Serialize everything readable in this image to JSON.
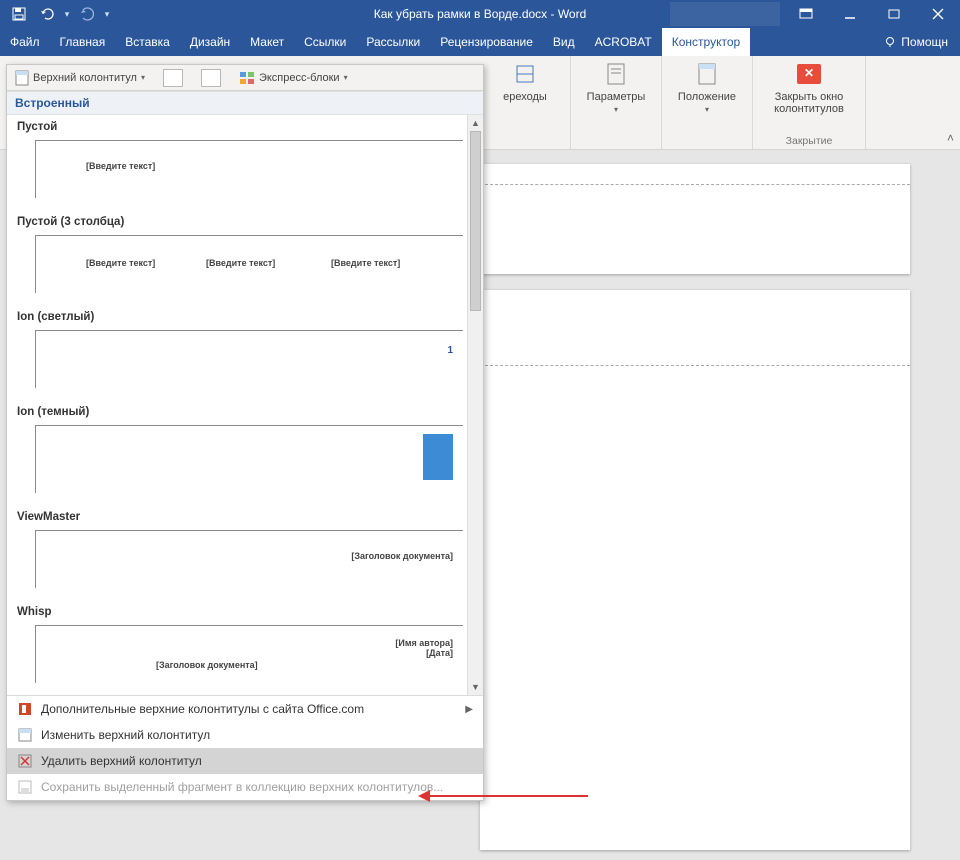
{
  "titlebar": {
    "doc_title": "Как убрать рамки в Ворде.docx - Word"
  },
  "tabs": {
    "file": "Файл",
    "home": "Главная",
    "insert": "Вставка",
    "design": "Дизайн",
    "layout": "Макет",
    "references": "Ссылки",
    "mailings": "Рассылки",
    "review": "Рецензирование",
    "view": "Вид",
    "acrobat": "ACROBAT",
    "constructor": "Конструктор",
    "help": "Помощн"
  },
  "ribbon": {
    "header_split": "Верхний колонтитул",
    "express_blocks": "Экспресс-блоки",
    "transitions": "ереходы",
    "parameters": "Параметры",
    "position": "Положение",
    "close_header": "Закрыть окно колонтитулов",
    "close_group": "Закрытие"
  },
  "gallery": {
    "section": "Встроенный",
    "cat_empty": "Пустой",
    "cat_empty3": "Пустой (3 столбца)",
    "cat_ion_light": "Ion (светлый)",
    "cat_ion_dark": "Ion (темный)",
    "cat_viewmaster": "ViewMaster",
    "cat_whisp": "Whisp",
    "placeholder_text": "[Введите текст]",
    "doc_title_ph": "[Заголовок документа]",
    "author_ph": "[Имя автора]",
    "date_ph": "[Дата]",
    "ion_num": "1",
    "footer_more": "Дополнительные верхние колонтитулы с сайта Office.com",
    "footer_edit": "Изменить верхний колонтитул",
    "footer_delete": "Удалить верхний колонтитул",
    "footer_save": "Сохранить выделенный фрагмент в коллекцию верхних колонтитулов..."
  }
}
